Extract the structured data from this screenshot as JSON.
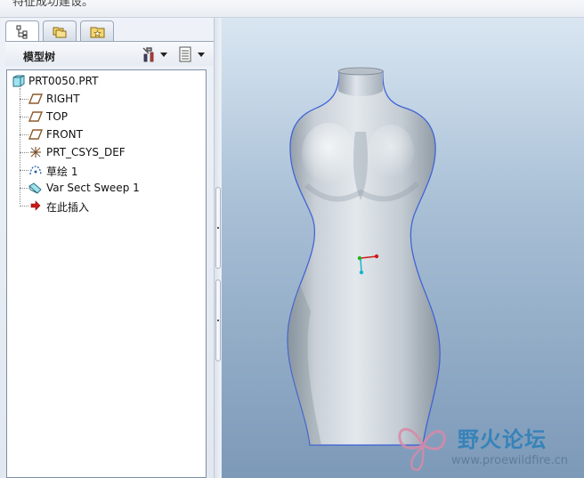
{
  "top_message": "特征成功建设。",
  "tabs": [
    {
      "name": "model-tree-tab",
      "icon": "tree-structure-icon"
    },
    {
      "name": "folder-browser-tab",
      "icon": "folder-stack-icon"
    },
    {
      "name": "favorites-tab",
      "icon": "star-folder-icon"
    }
  ],
  "tree_header": {
    "title": "模型树",
    "settings_icon": "tools-settings-icon",
    "show_icon": "list-view-icon"
  },
  "tree_items": [
    {
      "label": "PRT0050.PRT",
      "icon": "part-icon"
    },
    {
      "label": "RIGHT",
      "icon": "datum-plane-icon"
    },
    {
      "label": "TOP",
      "icon": "datum-plane-icon"
    },
    {
      "label": "FRONT",
      "icon": "datum-plane-icon"
    },
    {
      "label": "PRT_CSYS_DEF",
      "icon": "coordinate-system-icon"
    },
    {
      "label": "草绘 1",
      "icon": "sketch-icon"
    },
    {
      "label": "Var Sect Sweep 1",
      "icon": "sweep-feature-icon"
    },
    {
      "label": "在此插入",
      "icon": "insert-here-arrow-icon"
    }
  ],
  "watermark": {
    "title": "野火论坛",
    "url": "www.proewildfire.cn"
  },
  "colors": {
    "viewport_top": "#d9e6f2",
    "viewport_bottom": "#7c99b8",
    "model_surface": "#c3cbd3",
    "model_edge": "#3b5fd6",
    "insert_arrow": "#d01818",
    "watermark_blue": "#2a7fb9"
  }
}
